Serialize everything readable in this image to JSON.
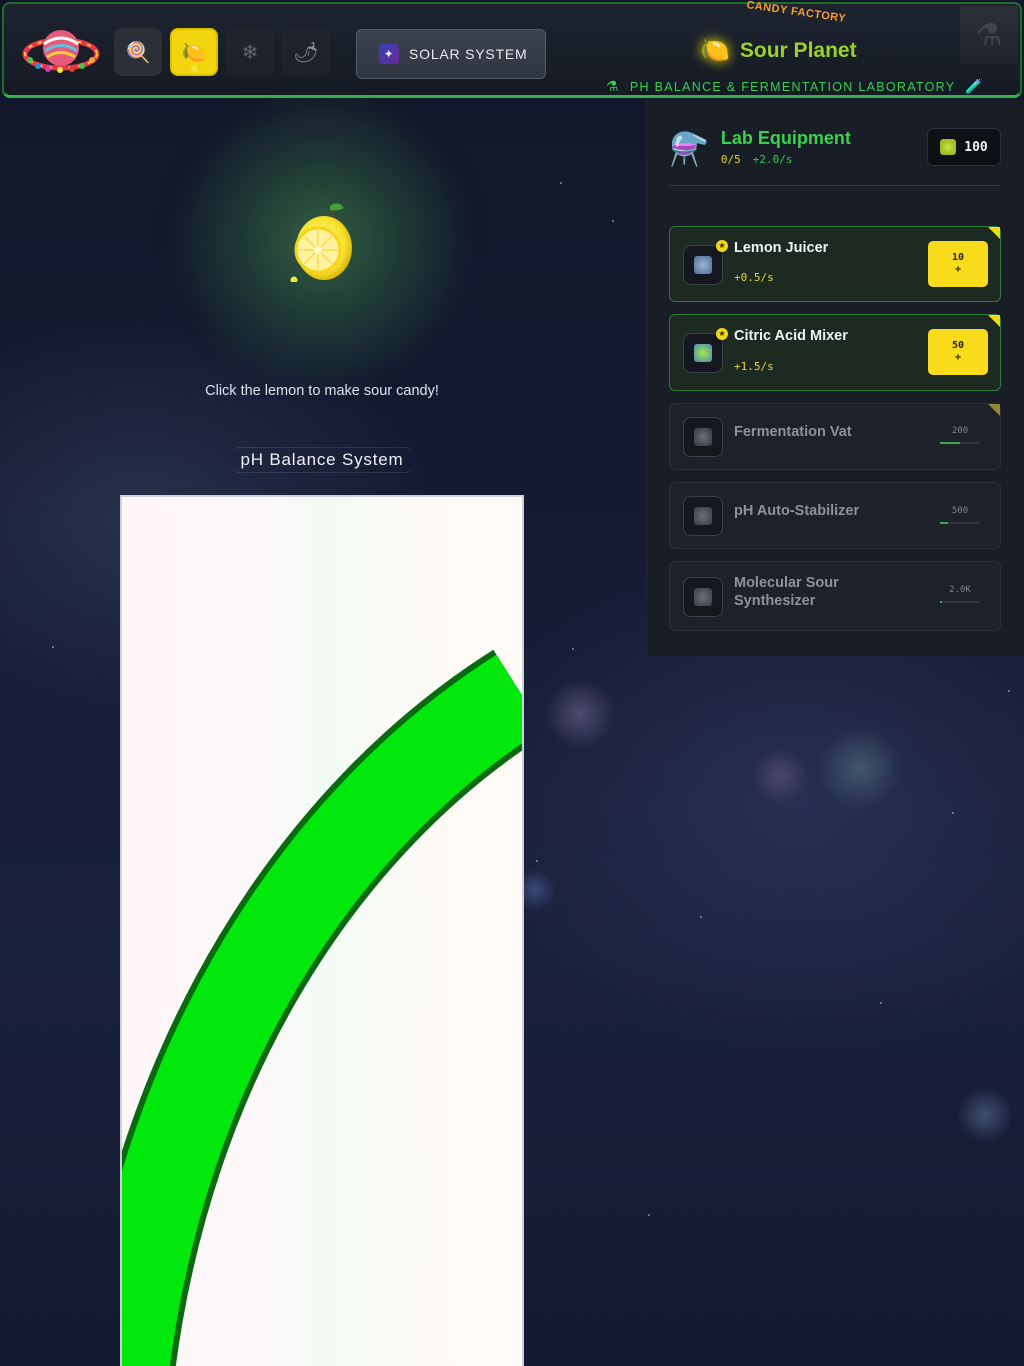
{
  "header": {
    "brand": "CANDY FACTORY",
    "world_buttons": [
      {
        "name": "candy",
        "icon": "🍭",
        "state": "normal"
      },
      {
        "name": "sour",
        "icon": "🍋",
        "state": "active"
      },
      {
        "name": "ice",
        "icon": "❄",
        "state": "locked"
      },
      {
        "name": "spicy",
        "icon": "🌶",
        "state": "locked"
      }
    ],
    "solar_system_label": "SOLAR SYSTEM",
    "planet_name": "Sour Planet",
    "subtitle": "PH BALANCE & FERMENTATION LABORATORY"
  },
  "main": {
    "prompt": "Click the lemon to make sour candy!",
    "ph_title": "pH Balance System",
    "ph_arc_color": "#00e80c"
  },
  "panel": {
    "title": "Lab Equipment",
    "owned": "0/5",
    "rate": "+2.0/s",
    "coins": "100",
    "items": [
      {
        "name": "Lemon Juicer",
        "rate": "+0.5/s",
        "cost": "10",
        "buy_suffix": "+",
        "affordable": true
      },
      {
        "name": "Citric Acid Mixer",
        "rate": "+1.5/s",
        "cost": "50",
        "buy_suffix": "+",
        "affordable": true
      },
      {
        "name": "Fermentation Vat",
        "rate": "",
        "cost": "200",
        "affordable": false,
        "progress": 0.5
      },
      {
        "name": "pH Auto-Stabilizer",
        "rate": "",
        "cost": "500",
        "affordable": false,
        "progress": 0.2
      },
      {
        "name": "Molecular Sour Synthesizer",
        "rate": "",
        "cost": "2.0K",
        "affordable": false,
        "progress": 0.05
      }
    ]
  }
}
